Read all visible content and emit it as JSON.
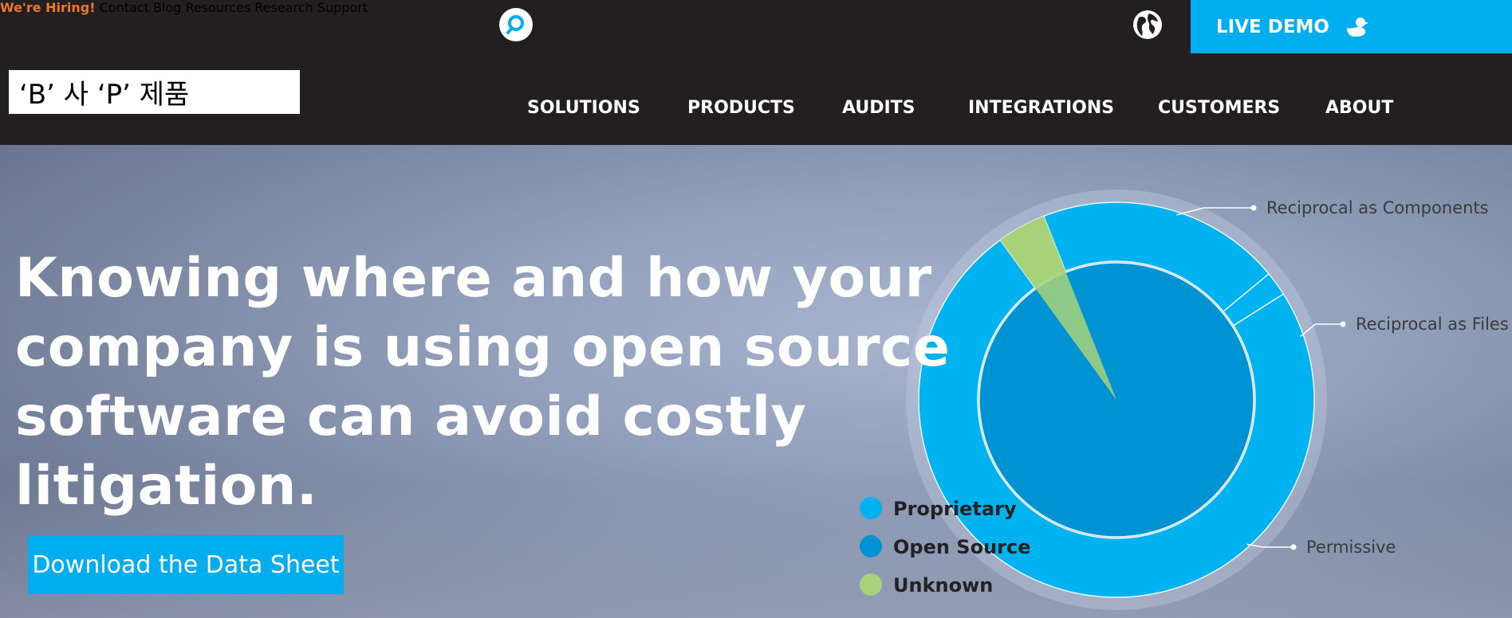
{
  "util_nav": {
    "hiring": "We're Hiring!",
    "contact": "Contact",
    "blog": "Blog",
    "resources": "Resources",
    "research": "Research",
    "support": "Support",
    "live_demo": "LIVE DEMO"
  },
  "annotation_label": "‘B’ 사 ‘P’ 제품",
  "main_nav": [
    "SOLUTIONS",
    "PRODUCTS",
    "AUDITS",
    "INTEGRATIONS",
    "CUSTOMERS",
    "ABOUT"
  ],
  "hero": {
    "headline_lines": [
      "Knowing where and how your",
      "company is using open source",
      "software can avoid costly",
      "litigation."
    ],
    "cta": "Download the Data Sheet"
  },
  "colors": {
    "accent": "#00aeef",
    "hiring": "#ee7624",
    "topbar": "#231f20",
    "proprietary": "#00b2ef",
    "open_source": "#0093d3",
    "unknown": "#a8d27a"
  },
  "icons": {
    "search": "search-icon",
    "globe": "globe-icon",
    "live_demo": "duck-icon"
  },
  "chart_data": {
    "type": "pie",
    "legend": [
      {
        "label": "Proprietary",
        "color": "#00b2ef"
      },
      {
        "label": "Open Source",
        "color": "#0093d3"
      },
      {
        "label": "Unknown",
        "color": "#a8d27a"
      }
    ],
    "outer_callouts": [
      "Reciprocal as Components",
      "Reciprocal as Files",
      "Permissive"
    ],
    "inner_ring": [
      {
        "label": "Open Source",
        "value": 96
      },
      {
        "label": "Unknown",
        "value": 4
      }
    ],
    "outer_ring": [
      {
        "label": "Unknown",
        "value": 4
      },
      {
        "label": "Reciprocal as Components",
        "value": 20
      },
      {
        "label": "Reciprocal as Files",
        "value": 2
      },
      {
        "label": "Permissive",
        "value": 74
      }
    ],
    "legend_position": "bottom-left"
  }
}
